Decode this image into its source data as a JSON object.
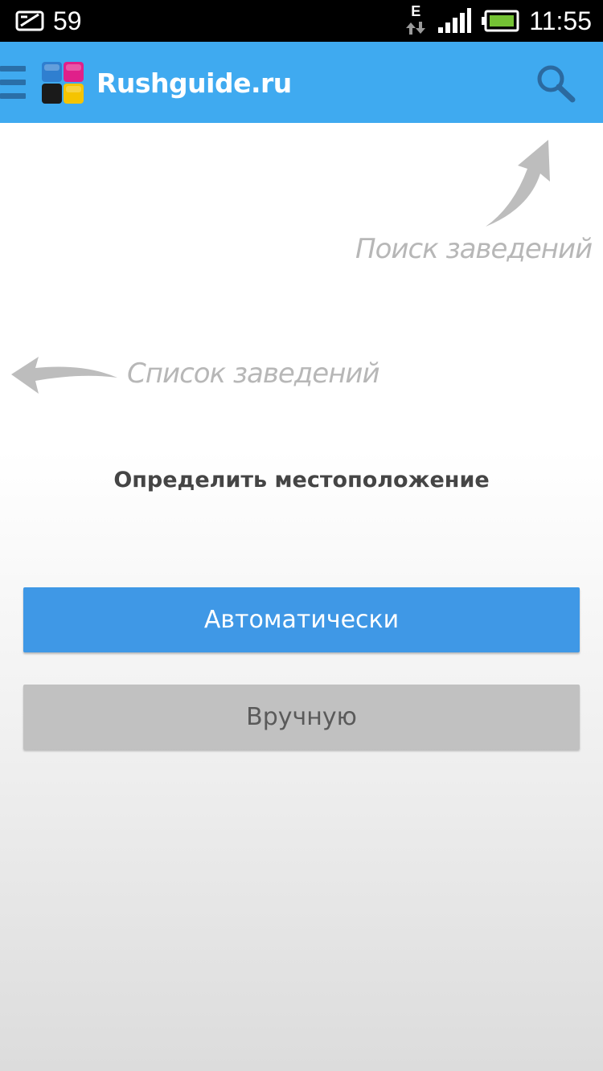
{
  "status_bar": {
    "notification_count": "59",
    "network_type": "E",
    "time": "11:55",
    "icons": [
      "notification-icon",
      "data-transfer-icon",
      "signal-icon",
      "battery-icon"
    ]
  },
  "app_bar": {
    "title": "Rushguide.ru",
    "color": "#3faaf0",
    "icons": [
      "menu-icon",
      "app-logo-icon",
      "search-icon"
    ]
  },
  "hints": {
    "search_hint": "Поиск заведений",
    "list_hint": "Список заведений"
  },
  "main": {
    "heading": "Определить местоположение",
    "auto_button_label": "Автоматически",
    "manual_button_label": "Вручную",
    "auto_button_color": "#3f98e6",
    "manual_button_color": "#c1c1c1"
  }
}
